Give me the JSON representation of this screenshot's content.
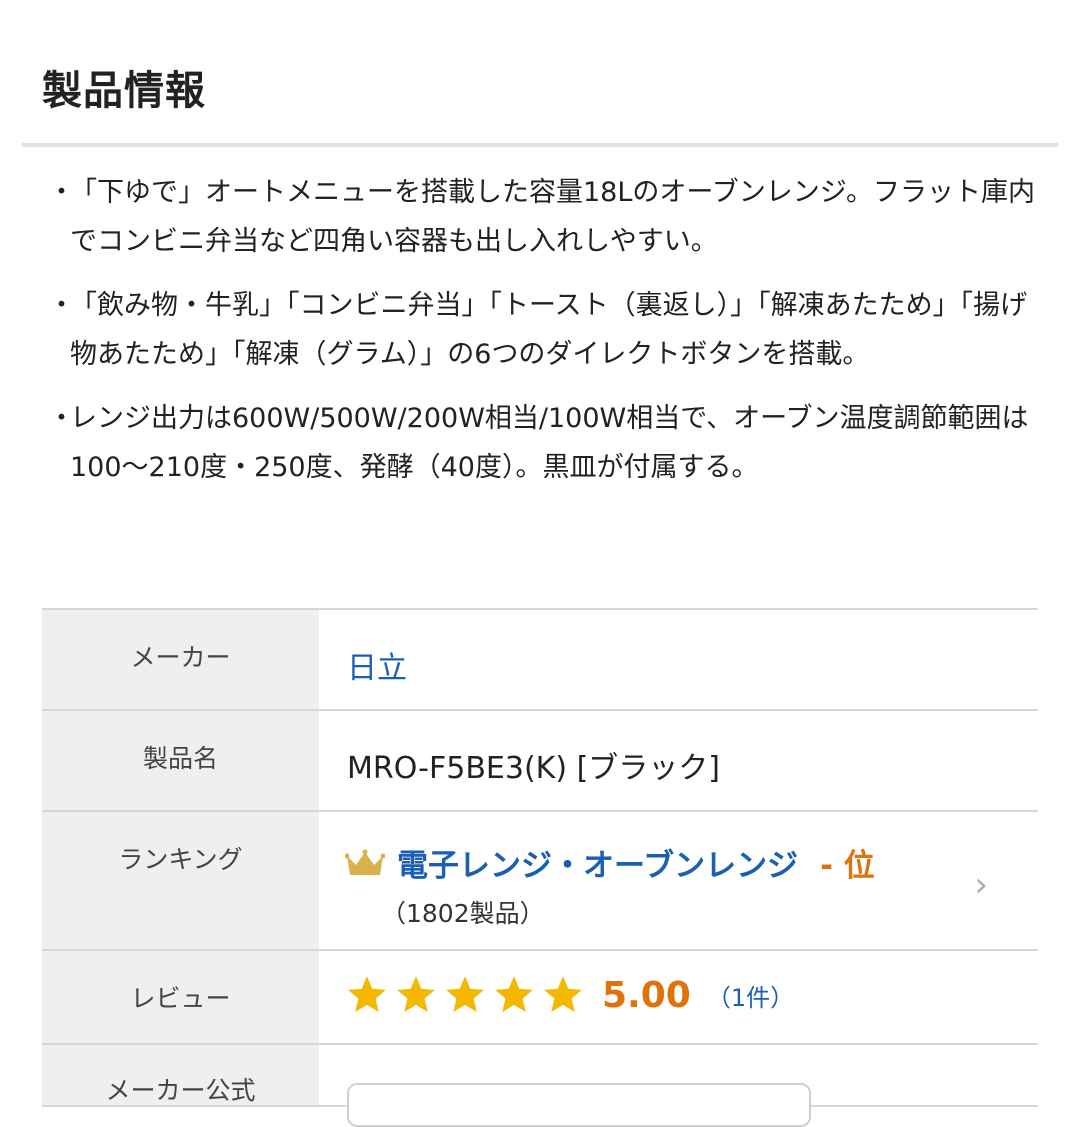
{
  "section": {
    "title": "製品情報"
  },
  "bullets": [
    {
      "dot": "・",
      "text": "「下ゆで」オートメニューを搭載した容量18Lのオーブンレンジ。フラット庫内でコンビニ弁当など四角い容器も出し入れしやすい。"
    },
    {
      "dot": "・",
      "text": "「飲み物・牛乳」「コンビニ弁当」「トースト（裏返し）」「解凍あたため」「揚げ物あたため」「解凍（グラム）」の6つのダイレクトボタンを搭載。"
    },
    {
      "dot": "・",
      "text": "レンジ出力は600W/500W/200W相当/100W相当で、オーブン温度調節範囲は100〜210度・250度、発酵（40度）。黒皿が付属する。"
    }
  ],
  "spec": {
    "maker": {
      "label": "メーカー",
      "value": "日立"
    },
    "product": {
      "label": "製品名",
      "value": "MRO-F5BE3(K) [ブラック]"
    },
    "ranking": {
      "label": "ランキング",
      "category": "電子レンジ・オーブンレンジ",
      "position": "- 位",
      "count": "（1802製品）",
      "icon": "crown-icon",
      "chevron": "›"
    },
    "review": {
      "label": "レビュー",
      "stars": 5,
      "score": "5.00",
      "count": "（1件）"
    },
    "official": {
      "label": "メーカー公式"
    }
  },
  "colors": {
    "link": "#1a5fb4",
    "accent": "#e0720c",
    "star": "#f5b800",
    "crown": "#d9b24a",
    "header_bg": "#efefef"
  }
}
